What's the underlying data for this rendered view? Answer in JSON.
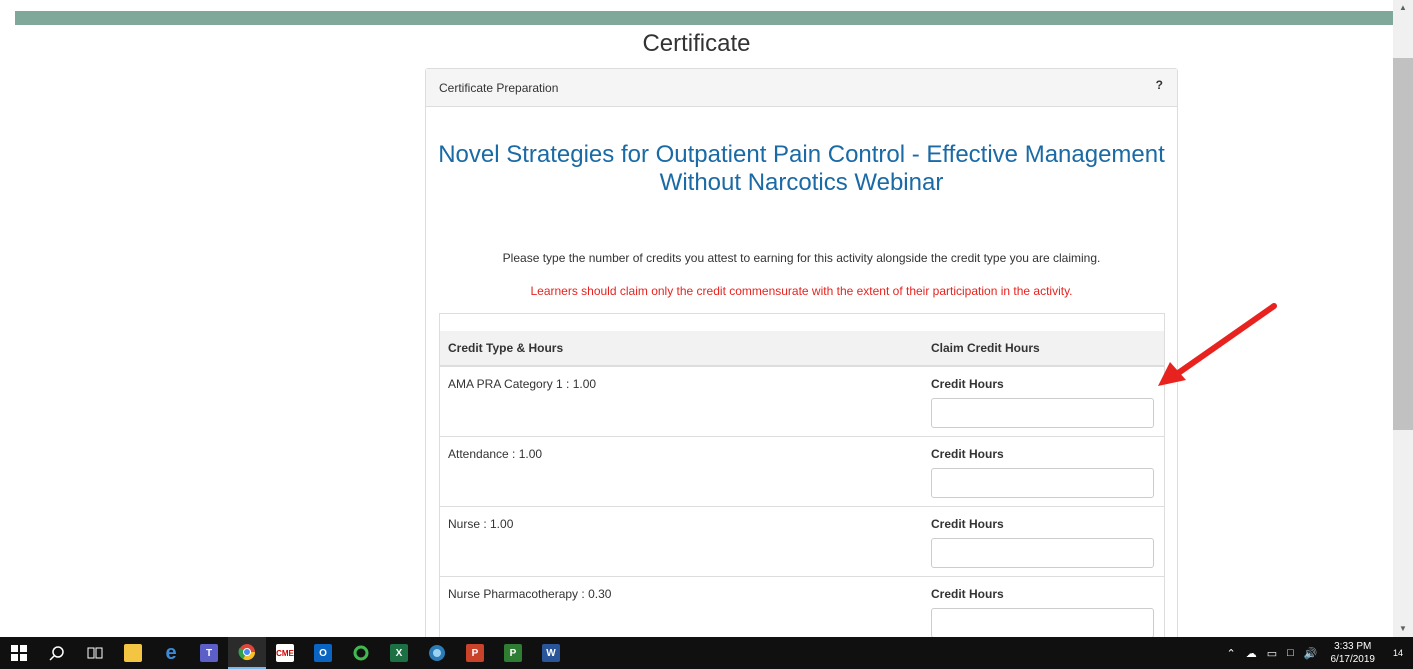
{
  "page": {
    "title": "Certificate"
  },
  "panel": {
    "heading": "Certificate Preparation",
    "help": "?",
    "activity_title": "Novel Strategies for Outpatient Pain Control - Effective Management Without Narcotics Webinar",
    "instructions": "Please type the number of credits you attest to earning for this activity alongside the credit type you are claiming.",
    "warning": "Learners should claim only the credit commensurate with the extent of their participation in the activity."
  },
  "credit_table": {
    "headers": [
      "Credit Type & Hours",
      "Claim Credit Hours"
    ],
    "rows": [
      {
        "type": "AMA PRA Category 1 : 1.00",
        "claim_label": "Credit Hours",
        "value": ""
      },
      {
        "type": "Attendance : 1.00",
        "claim_label": "Credit Hours",
        "value": ""
      },
      {
        "type": "Nurse : 1.00",
        "claim_label": "Credit Hours",
        "value": ""
      },
      {
        "type": "Nurse Pharmacotherapy : 0.30",
        "claim_label": "Credit Hours",
        "value": ""
      }
    ]
  },
  "colors": {
    "banner": "#7fa79a",
    "activity_title": "#1a6aa6",
    "warning": "#e8231f",
    "arrow": "#e8231f"
  },
  "taskbar": {
    "icons": [
      "windows-start-icon",
      "search-icon",
      "task-view-icon",
      "file-explorer-icon",
      "edge-icon",
      "teams-icon",
      "chrome-icon",
      "cme-app-icon",
      "outlook-icon",
      "sync-icon",
      "excel-icon",
      "network-app-icon",
      "powerpoint-icon",
      "project-icon",
      "word-icon"
    ],
    "clock_time": "3:33 PM",
    "clock_date": "6/17/2019",
    "notification_count": "14"
  }
}
